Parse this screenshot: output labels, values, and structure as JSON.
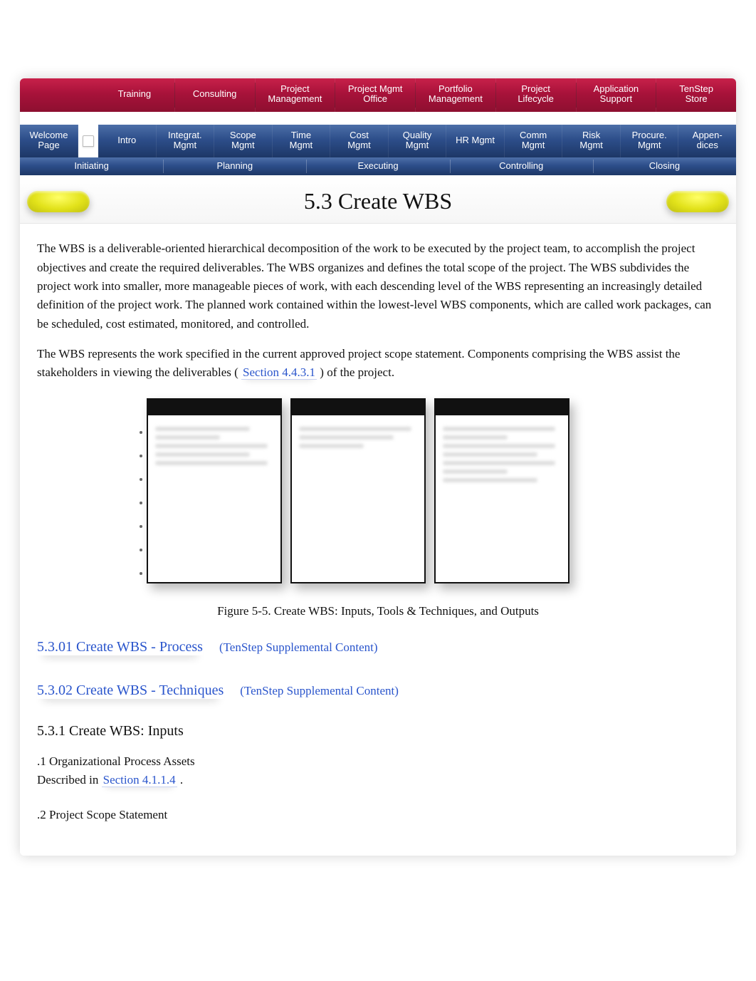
{
  "nav_top": [
    "Training",
    "Consulting",
    "Project\nManagement",
    "Project Mgmt\nOffice",
    "Portfolio\nManagement",
    "Project\nLifecycle",
    "Application\nSupport",
    "TenStep\nStore"
  ],
  "nav_mid": {
    "welcome": "Welcome\nPage",
    "items": [
      "Intro",
      "Integrat.\nMgmt",
      "Scope\nMgmt",
      "Time\nMgmt",
      "Cost\nMgmt",
      "Quality\nMgmt",
      "HR Mgmt",
      "Comm\nMgmt",
      "Risk\nMgmt",
      "Procure.\nMgmt",
      "Appen-\ndices"
    ]
  },
  "nav_phase": [
    "Initiating",
    "Planning",
    "Executing",
    "Controlling",
    "Closing"
  ],
  "page_title": "5.3 Create WBS",
  "paragraphs": {
    "p1": "The WBS is a deliverable-oriented hierarchical decomposition of the work to be executed by the project team, to accomplish the project objectives and create the required deliverables. The WBS organizes and defines the total scope of the project. The WBS subdivides the project work into smaller, more manageable pieces of work, with each descending level of the WBS representing an increasingly detailed definition of the project work. The planned work contained within the lowest-level WBS components, which are called work packages, can be scheduled, cost estimated, monitored, and controlled.",
    "p2_a": "The WBS represents the work specified in the current approved project scope statement. Components comprising the WBS assist the stakeholders in viewing the deliverables (",
    "p2_link": "Section 4.4.3.1",
    "p2_b": ") of the project."
  },
  "figure_caption": "Figure 5-5. Create WBS: Inputs, Tools & Techniques, and Outputs",
  "supplemental": [
    {
      "primary": "5.3.01 Create WBS - Process",
      "suffix": "(TenStep Supplemental Content)"
    },
    {
      "primary": "5.3.02 Create WBS - Techniques",
      "suffix": "(TenStep Supplemental Content)"
    }
  ],
  "section_inputs": {
    "heading": "5.3.1 Create WBS: Inputs",
    "item1_title": ".1 Organizational Process Assets",
    "item1_desc_a": "Described in ",
    "item1_desc_link": "Section 4.1.1.4",
    "item1_desc_b": ".",
    "item2_title": ".2 Project Scope Statement"
  }
}
